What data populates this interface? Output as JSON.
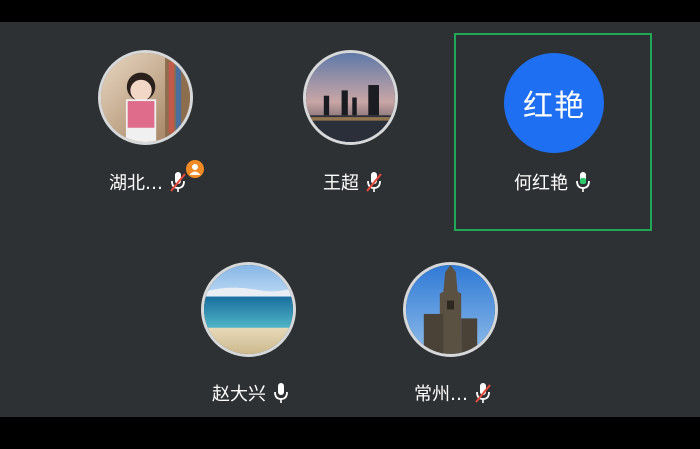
{
  "participants": [
    {
      "name": "湖北…",
      "mic": "muted",
      "host": true,
      "avatar": "photo-girl-with-book"
    },
    {
      "name": "王超",
      "mic": "muted",
      "host": false,
      "avatar": "photo-city-night-skyline"
    },
    {
      "name": "何红艳",
      "mic": "speaking",
      "host": false,
      "avatar_initials": "红艳",
      "active": true
    },
    {
      "name": "赵大兴",
      "mic": "on",
      "host": false,
      "avatar": "photo-beach-ocean"
    },
    {
      "name": "常州…",
      "mic": "muted",
      "host": false,
      "avatar": "photo-gothic-tower"
    }
  ],
  "colors": {
    "background": "#2e3133",
    "active_border": "#1fa855",
    "initials_bg": "#1f6ff2",
    "host_badge": "#f08a24",
    "mic_speaking": "#2cc76a",
    "mute_slash": "#e64a3c"
  }
}
